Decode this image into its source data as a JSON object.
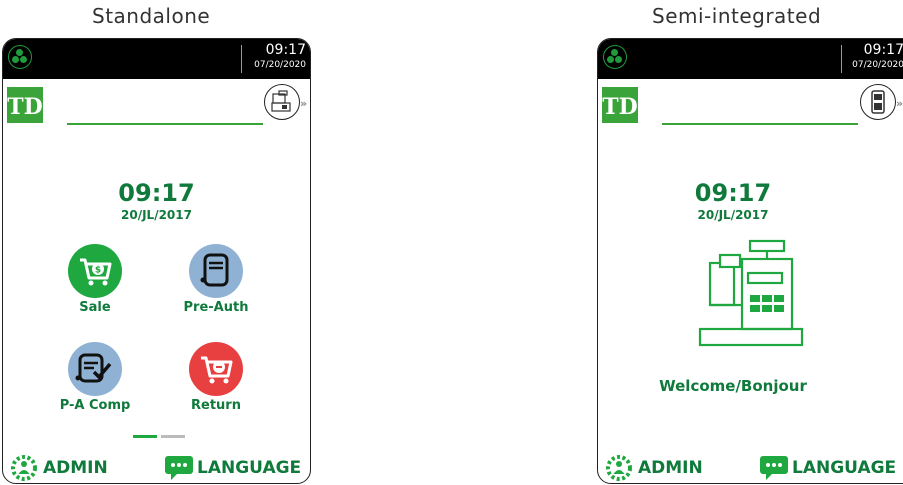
{
  "panels": {
    "standalone": {
      "title": "Standalone",
      "status_time": "09:17",
      "status_date": "07/20/2020",
      "display_time": "09:17",
      "display_date": "20/JL/2017",
      "tiles": [
        {
          "label": "Sale",
          "icon": "cart-dollar-icon",
          "color": "#1fa83f"
        },
        {
          "label": "Pre-Auth",
          "icon": "receipt-icon",
          "color": "#8fb2d4"
        },
        {
          "label": "P-A Comp",
          "icon": "receipt-check-icon",
          "color": "#8fb2d4"
        },
        {
          "label": "Return",
          "icon": "cart-minus-icon",
          "color": "#e84040"
        }
      ],
      "admin_label": "ADMIN",
      "language_label": "LANGUAGE",
      "mode_icon": "cash-register-icon"
    },
    "semi": {
      "title": "Semi-integrated",
      "status_time": "09:17",
      "status_date": "07/20/2020",
      "display_time": "09:17",
      "display_date": "20/JL/2017",
      "welcome": "Welcome/Bonjour",
      "admin_label": "ADMIN",
      "language_label": "LANGUAGE",
      "mode_icon": "terminal-icon"
    }
  },
  "brand": {
    "logo_text": "TD",
    "accent": "#3aa339",
    "dark_green": "#0f7a3b"
  }
}
